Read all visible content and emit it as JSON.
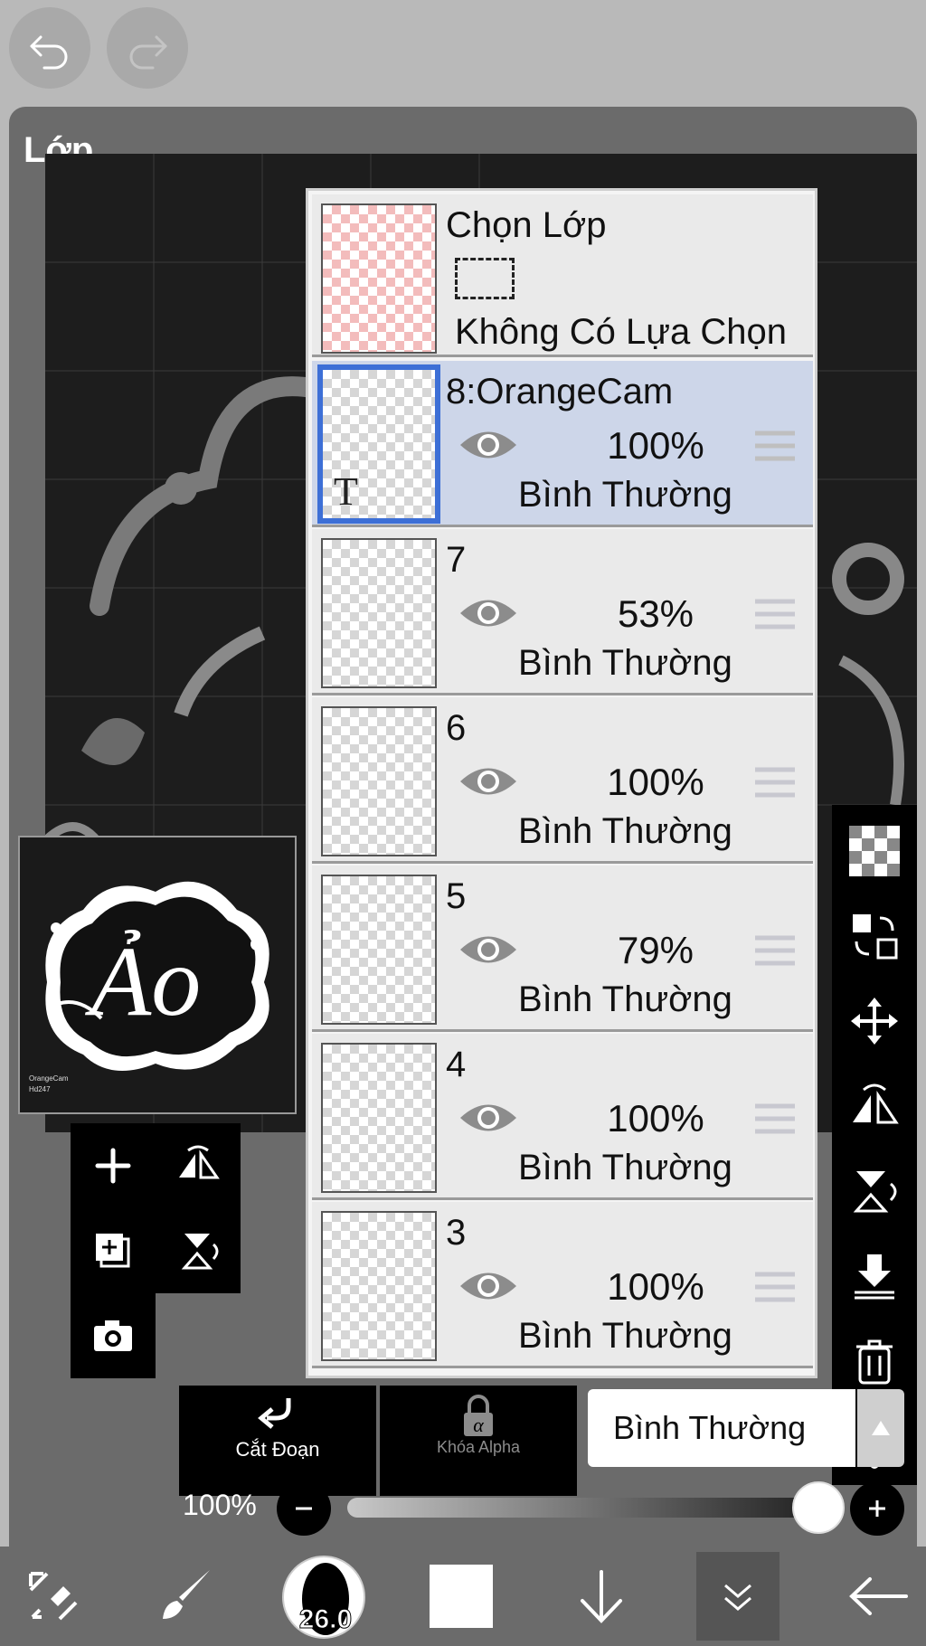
{
  "app": {
    "undo_icon": "undo-icon",
    "redo_icon": "redo-icon"
  },
  "panel": {
    "title": "Lớp"
  },
  "preview": {
    "caption_line1": "OrangeCam",
    "caption_line2": "Hd247"
  },
  "selection_layer": {
    "title": "Chọn Lớp",
    "status": "Không Có Lựa Chọn"
  },
  "layers": [
    {
      "name": "8:OrangeCam",
      "opacity": "100%",
      "blend": "Bình Thường",
      "selected": true,
      "text_layer": true
    },
    {
      "name": "7",
      "opacity": "53%",
      "blend": "Bình Thường",
      "selected": false
    },
    {
      "name": "6",
      "opacity": "100%",
      "blend": "Bình Thường",
      "selected": false
    },
    {
      "name": "5",
      "opacity": "79%",
      "blend": "Bình Thường",
      "selected": false
    },
    {
      "name": "4",
      "opacity": "100%",
      "blend": "Bình Thường",
      "selected": false
    },
    {
      "name": "3",
      "opacity": "100%",
      "blend": "Bình Thường",
      "selected": false
    }
  ],
  "layer_actions": {
    "clip_label": "Cắt Đoạn",
    "alpha_lock_label": "Khóa Alpha",
    "blend_mode": "Bình Thường"
  },
  "opacity_control": {
    "label": "100%",
    "value": 1.0
  },
  "toolbar": {
    "brush_size": "26.0"
  },
  "colors": {
    "selected_row": "#cdd6e9",
    "selected_border": "#3d6fd6",
    "panel_bg": "#6b6b6b"
  }
}
